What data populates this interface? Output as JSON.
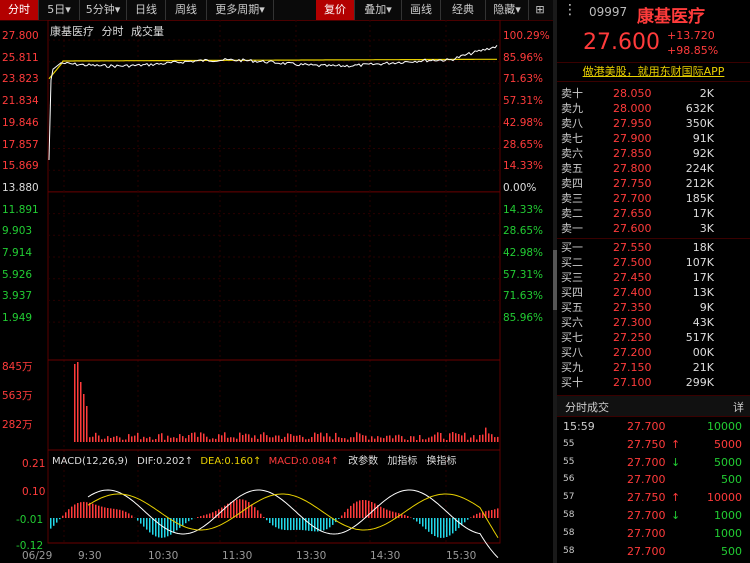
{
  "toolbar": {
    "tabs": [
      {
        "label": "分时"
      },
      {
        "label": "5日"
      },
      {
        "label": "5分钟"
      },
      {
        "label": "日线"
      },
      {
        "label": "周线"
      },
      {
        "label": "更多周期"
      },
      {
        "label": "复价"
      },
      {
        "label": "叠加"
      },
      {
        "label": "画线"
      },
      {
        "label": "经典"
      },
      {
        "label": "隐藏"
      }
    ],
    "chevron_down": "▾",
    "menu_label": "⋮",
    "grid_icon_label": "⊞"
  },
  "chart_header": {
    "name": "康基医疗",
    "mode": "分时",
    "volume": "成交量"
  },
  "price_axis": {
    "left": [
      "27.800",
      "25.811",
      "23.823",
      "21.834",
      "19.846",
      "17.857",
      "15.869",
      "13.880",
      "11.891",
      "9.903",
      "7.914",
      "5.926",
      "3.937",
      "1.949"
    ],
    "right": [
      "100.29%",
      "85.96%",
      "71.63%",
      "57.31%",
      "42.98%",
      "28.65%",
      "14.33%",
      "0.00%",
      "14.33%",
      "28.65%",
      "42.98%",
      "57.31%",
      "71.63%",
      "85.96%"
    ]
  },
  "volume_axis": {
    "labels": [
      "845万",
      "563万",
      "282万"
    ]
  },
  "macd": {
    "title": "MACD(12,26,9)",
    "dif": "DIF:0.202",
    "dea": "DEA:0.160",
    "macd": "MACD:0.084",
    "arrow_up": "↑",
    "links": [
      "改参数",
      "加指标",
      "换指标"
    ],
    "axis": [
      "0.21",
      "0.10",
      "-0.01",
      "-0.12"
    ]
  },
  "time_axis": [
    "06/29",
    "9:30",
    "10:30",
    "11:30",
    "13:30",
    "14:30",
    "15:30"
  ],
  "quote": {
    "code": "09997",
    "name": "康基医疗",
    "price": "27.600",
    "change": "+13.720",
    "change_pct": "+98.85%",
    "banner": "做港美股，就用东财国际APP"
  },
  "asks": [
    {
      "label": "卖十",
      "price": "28.050",
      "vol": "2K"
    },
    {
      "label": "卖九",
      "price": "28.000",
      "vol": "632K"
    },
    {
      "label": "卖八",
      "price": "27.950",
      "vol": "350K"
    },
    {
      "label": "卖七",
      "price": "27.900",
      "vol": "91K"
    },
    {
      "label": "卖六",
      "price": "27.850",
      "vol": "92K"
    },
    {
      "label": "卖五",
      "price": "27.800",
      "vol": "224K"
    },
    {
      "label": "卖四",
      "price": "27.750",
      "vol": "212K"
    },
    {
      "label": "卖三",
      "price": "27.700",
      "vol": "185K"
    },
    {
      "label": "卖二",
      "price": "27.650",
      "vol": "17K"
    },
    {
      "label": "卖一",
      "price": "27.600",
      "vol": "3K"
    }
  ],
  "bids": [
    {
      "label": "买一",
      "price": "27.550",
      "vol": "18K"
    },
    {
      "label": "买二",
      "price": "27.500",
      "vol": "107K"
    },
    {
      "label": "买三",
      "price": "27.450",
      "vol": "17K"
    },
    {
      "label": "买四",
      "price": "27.400",
      "vol": "13K"
    },
    {
      "label": "买五",
      "price": "27.350",
      "vol": "9K"
    },
    {
      "label": "买六",
      "price": "27.300",
      "vol": "43K"
    },
    {
      "label": "买七",
      "price": "27.250",
      "vol": "517K"
    },
    {
      "label": "买八",
      "price": "27.200",
      "vol": "00K"
    },
    {
      "label": "买九",
      "price": "27.150",
      "vol": "21K"
    },
    {
      "label": "买十",
      "price": "27.100",
      "vol": "299K"
    }
  ],
  "ticks_header": {
    "title": "分时成交",
    "detail": "详"
  },
  "ticks": [
    {
      "time": "15:59",
      "price": "27.700",
      "dir": "",
      "vol": "10000"
    },
    {
      "time": "55",
      "price": "27.750",
      "dir": "↑",
      "vol": "5000"
    },
    {
      "time": "55",
      "price": "27.700",
      "dir": "↓",
      "vol": "5000"
    },
    {
      "time": "56",
      "price": "27.700",
      "dir": "",
      "vol": "500"
    },
    {
      "time": "57",
      "price": "27.750",
      "dir": "↑",
      "vol": "10000"
    },
    {
      "time": "58",
      "price": "27.700",
      "dir": "↓",
      "vol": "1000"
    },
    {
      "time": "58",
      "price": "27.700",
      "dir": "",
      "vol": "1000"
    },
    {
      "time": "58",
      "price": "27.700",
      "dir": "",
      "vol": "500"
    }
  ],
  "colors": {
    "up": "#ff3b3b",
    "down": "#22cc33",
    "price_line": "#ffffff",
    "avg_line": "#e8d000",
    "accent": "#b30000",
    "macd_dea": "#e8d000",
    "macd_neg": "#22d8e8"
  }
}
